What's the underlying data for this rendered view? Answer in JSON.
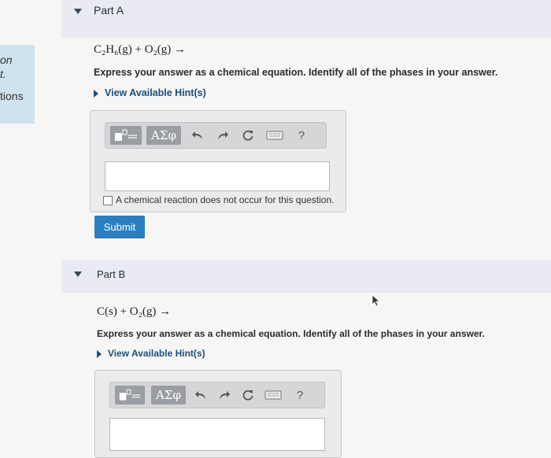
{
  "sidebar": {
    "fragments": [
      "on",
      "t.",
      "tions"
    ]
  },
  "part_a": {
    "title": "Part A",
    "equation": "C₂H₆(g) + O₂(g) →",
    "instruction": "Express your answer as a chemical equation. Identify all of the phases in your answer.",
    "hint_label": "View Available Hint(s)",
    "toolbar": {
      "symbols_label": "ΑΣφ",
      "help_label": "?"
    },
    "answer_value": "",
    "no_reaction_label": "A chemical reaction does not occur for this question.",
    "submit_label": "Submit"
  },
  "part_b": {
    "title": "Part B",
    "equation": "C(s) + O₂(g) →",
    "instruction": "Express your answer as a chemical equation. Identify all of the phases in your answer.",
    "hint_label": "View Available Hint(s)",
    "toolbar": {
      "symbols_label": "ΑΣφ",
      "help_label": "?"
    }
  },
  "colors": {
    "accent": "#2a7fc1",
    "hint": "#1d4e7a",
    "sidebar": "#cfe3ee"
  }
}
